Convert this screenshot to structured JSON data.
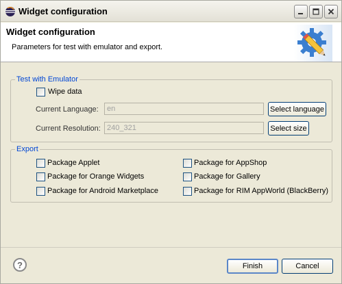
{
  "window": {
    "title": "Widget configuration"
  },
  "header": {
    "title": "Widget configuration",
    "description": "Parameters for test with emulator and export."
  },
  "emulator": {
    "group_title": "Test with Emulator",
    "wipe_data_label": "Wipe data",
    "wipe_data_checked": false,
    "language_label": "Current Language:",
    "language_value": "en",
    "select_language_label": "Select language",
    "resolution_label": "Current Resolution:",
    "resolution_value": "240_321",
    "select_size_label": "Select size"
  },
  "export": {
    "group_title": "Export",
    "options": [
      {
        "label": "Package Applet",
        "checked": false
      },
      {
        "label": "Package for AppShop",
        "checked": false
      },
      {
        "label": "Package for Orange Widgets",
        "checked": false
      },
      {
        "label": "Package for Gallery",
        "checked": false
      },
      {
        "label": "Package for Android Marketplace",
        "checked": false
      },
      {
        "label": "Package for RIM AppWorld (BlackBerry)",
        "checked": false
      }
    ]
  },
  "footer": {
    "help_glyph": "?",
    "finish_label": "Finish",
    "cancel_label": "Cancel"
  },
  "icons": {
    "window_icon": "eclipse-icon",
    "banner_icon": "gear-pencil-icon",
    "help_icon": "help-icon"
  },
  "colors": {
    "group_title": "#0046d5",
    "window_bg": "#ece9d8",
    "header_bg": "#ffffff"
  }
}
